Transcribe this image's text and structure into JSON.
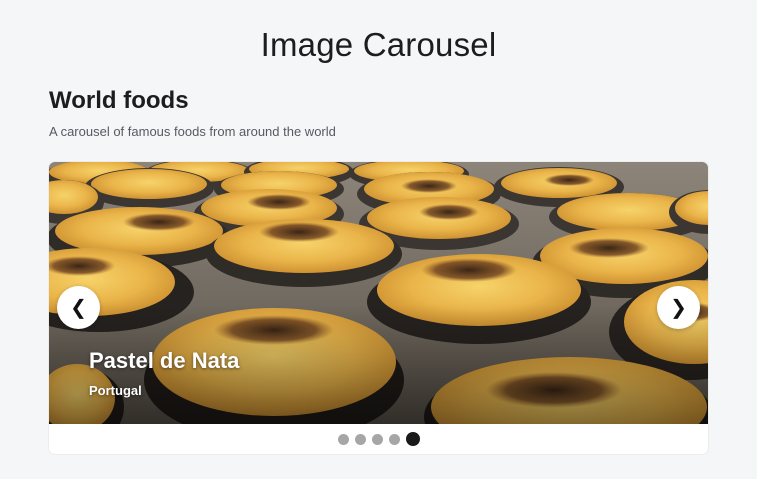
{
  "page": {
    "title": "Image Carousel"
  },
  "section": {
    "heading": "World foods",
    "description": "A carousel of famous foods from around the world"
  },
  "carousel": {
    "current_slide": {
      "title": "Pastel de Nata",
      "subtitle": "Portugal"
    },
    "prev_label": "❮",
    "next_label": "❯",
    "slide_count": 5,
    "active_index": 4
  },
  "colors": {
    "background": "#f5f6f8",
    "dot_inactive": "#a6a6a6",
    "dot_active": "#1a1a1a"
  }
}
